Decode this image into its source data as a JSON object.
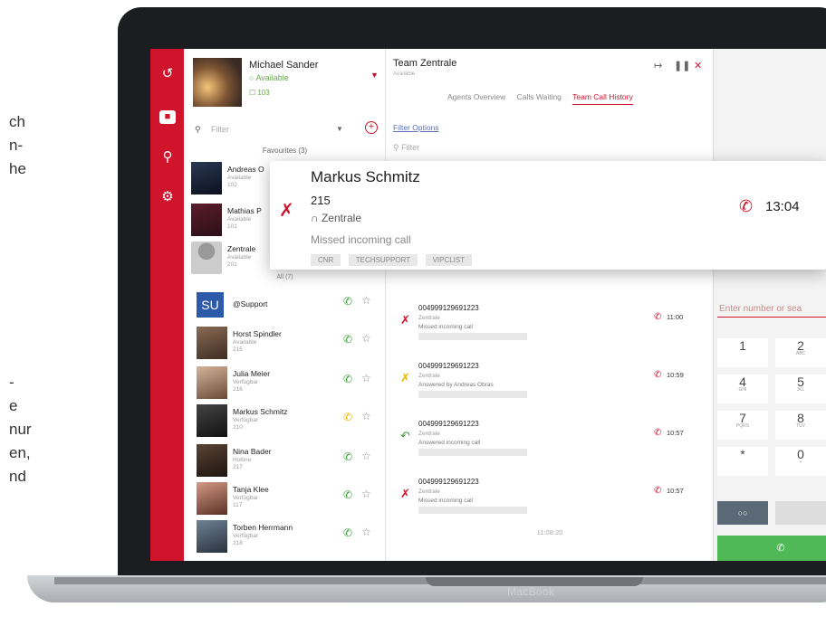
{
  "background_text": [
    "ch",
    "n-",
    "he",
    "-",
    "e",
    "nur",
    "en,",
    "nd"
  ],
  "device": {
    "label": "MacBook"
  },
  "user": {
    "name": "Michael Sander",
    "status": "Available",
    "ext": "103"
  },
  "contacts": {
    "filter_placeholder": "Filter",
    "favourites_label": "Favourites (3)",
    "all_label": "All (7)",
    "favourites": [
      {
        "name": "Andreas O",
        "status": "Available",
        "ext": "102"
      },
      {
        "name": "Mathias P",
        "status": "Available",
        "ext": "101"
      },
      {
        "name": "Zentrale",
        "status": "Available",
        "ext": "201"
      }
    ],
    "all": [
      {
        "name": "@Support",
        "status": "",
        "ext": "",
        "avatar": "SU",
        "call_color": "#3a9d3a"
      },
      {
        "name": "Horst Spindler",
        "status": "Available",
        "ext": "215",
        "avatar": "",
        "call_color": "#3a9d3a"
      },
      {
        "name": "Julia Meier",
        "status": "Verfügbar",
        "ext": "216",
        "avatar": "",
        "call_color": "#3a9d3a"
      },
      {
        "name": "Markus Schmitz",
        "status": "Verfügbar",
        "ext": "210",
        "avatar": "",
        "call_color": "#e5b700"
      },
      {
        "name": "Nina Bader",
        "status": "Hotline",
        "ext": "217",
        "avatar": "",
        "call_color": "#3a9d3a"
      },
      {
        "name": "Tanja Klee",
        "status": "Verfügbar",
        "ext": "117",
        "avatar": "",
        "call_color": "#3a9d3a"
      },
      {
        "name": "Torben Herrmann",
        "status": "Verfügbar",
        "ext": "218",
        "avatar": "",
        "call_color": "#3a9d3a"
      }
    ]
  },
  "team": {
    "title": "Team Zentrale",
    "subtitle": "Available",
    "tabs": [
      "Agents Overview",
      "Calls Waiting",
      "Team Call History"
    ],
    "active_tab": "Team Call History",
    "filter_options": "Filter Options",
    "search_placeholder": "Filter",
    "entries": [
      {
        "number": "004999129691223",
        "queue": "Zentrale",
        "desc": "Missed incoming call",
        "time": "11:00",
        "icon_color": "#d0142c"
      },
      {
        "number": "004999129691223",
        "queue": "Zentrale",
        "desc": "Answered by Andreas Obras",
        "time": "10:59",
        "icon_color": "#e5b700"
      },
      {
        "number": "004999129691223",
        "queue": "Zentrale",
        "desc": "Answered incoming call",
        "time": "10:57",
        "icon_color": "#3a9d3a"
      },
      {
        "number": "004999129691223",
        "queue": "Zentrale",
        "desc": "Missed incoming call",
        "time": "10:57",
        "icon_color": "#d0142c"
      }
    ],
    "footer_time": "11:08:20"
  },
  "popup": {
    "name": "Markus Schmitz",
    "ext": "215",
    "queue": "Zentrale",
    "description": "Missed incoming call",
    "tags": [
      "CNR",
      "TECHSUPPORT",
      "VIPCLIST"
    ],
    "time": "13:04"
  },
  "dialer": {
    "placeholder": "Enter number or sea",
    "keys": [
      {
        "digit": "1",
        "letters": ""
      },
      {
        "digit": "2",
        "letters": "ABC"
      },
      {
        "digit": "4",
        "letters": "GHI"
      },
      {
        "digit": "5",
        "letters": "JKL"
      },
      {
        "digit": "7",
        "letters": "PQRS"
      },
      {
        "digit": "8",
        "letters": "TUV"
      },
      {
        "digit": "*",
        "letters": ""
      },
      {
        "digit": "0",
        "letters": "+"
      }
    ],
    "voicemail_icon": "voicemail-icon",
    "call_icon": "phone-icon"
  },
  "colors": {
    "brand_red": "#d0142c",
    "green": "#4fb957",
    "yellow": "#e5b700"
  }
}
